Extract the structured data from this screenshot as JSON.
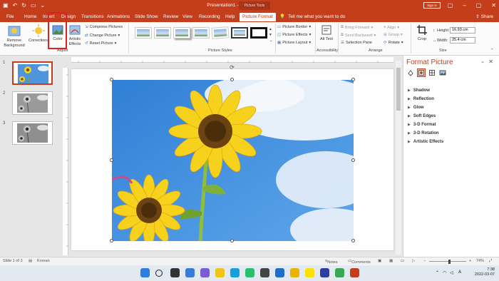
{
  "titlebar": {
    "title": "Presentation1 - PowerPoint",
    "context_tab": "Picture Tools",
    "sign_in": "Sign in",
    "qa_icons": [
      "save-icon",
      "undo-icon",
      "redo-icon",
      "present-icon",
      "more-icon"
    ]
  },
  "tabs": [
    "File",
    "Home",
    "Insert",
    "Design",
    "Transitions",
    "Animations",
    "Slide Show",
    "Review",
    "View",
    "Recording",
    "Help",
    "Picture Format"
  ],
  "active_tab": "Picture Format",
  "tell_me": "Tell me what you want to do",
  "share": "Share",
  "ribbon": {
    "remove_background": "Remove Background",
    "corrections": "Corrections",
    "color": "Color",
    "artistic_effects": "Artistic Effects",
    "compress_pictures": "Compress Pictures",
    "change_picture": "Change Picture",
    "reset_picture": "Reset Picture",
    "group_adjust": "Adjust",
    "group_picture_styles": "Picture Styles",
    "picture_border": "Picture Border",
    "picture_effects": "Picture Effects",
    "picture_layout": "Picture Layout",
    "alt_text": "Alt Text",
    "group_accessibility": "Accessibility",
    "bring_forward": "Bring Forward",
    "send_backward": "Send Backward",
    "selection_pane": "Selection Pane",
    "align": "Align",
    "group": "Group",
    "rotate": "Rotate",
    "group_arrange": "Arrange",
    "crop": "Crop",
    "height_label": "Height:",
    "height_value": "16.93 cm",
    "width_label": "Width:",
    "width_value": "25.4 cm",
    "group_size": "Size"
  },
  "slides": [
    {
      "number": "1",
      "selected": true
    },
    {
      "number": "2",
      "selected": false
    },
    {
      "number": "3",
      "selected": false
    }
  ],
  "format_pane": {
    "title": "Format Picture",
    "sections": [
      "Shadow",
      "Reflection",
      "Glow",
      "Soft Edges",
      "3-D Format",
      "3-D Rotation",
      "Artistic Effects"
    ]
  },
  "status": {
    "slide_info": "Slide 1 of 3",
    "language": "Korean",
    "notes": "Notes",
    "comments": "Comments",
    "zoom": "74%"
  },
  "taskbar": {
    "time": "7:38",
    "date": "2022-03-07",
    "lang": "A"
  },
  "colors": {
    "accent": "#c43e1c",
    "ribbon_bg": "#fbfbfb",
    "workspace_bg": "#e6e6e6"
  }
}
